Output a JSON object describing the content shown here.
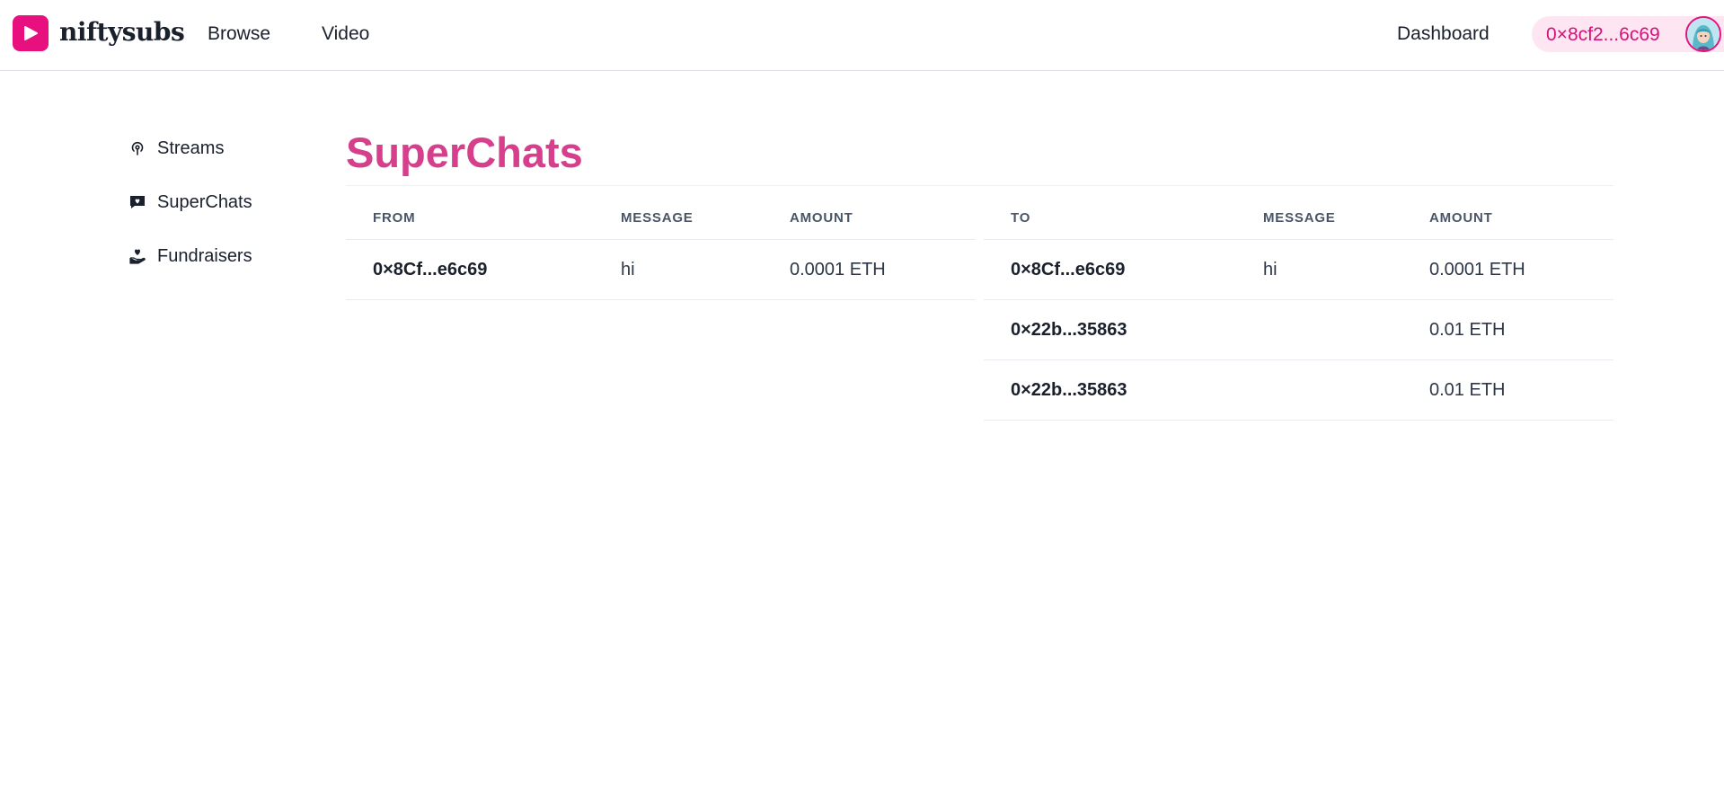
{
  "header": {
    "brand": "niftysubs",
    "nav": [
      "Browse",
      "Video"
    ],
    "dashboard_label": "Dashboard",
    "wallet_address": "0×8cf2...6c69",
    "accent_color": "#e8107e"
  },
  "sidebar": {
    "items": [
      {
        "label": "Streams",
        "icon": "broadcast-icon"
      },
      {
        "label": "SuperChats",
        "icon": "chat-bubble-heart-icon"
      },
      {
        "label": "Fundraisers",
        "icon": "hand-heart-icon"
      }
    ]
  },
  "main": {
    "title": "SuperChats",
    "title_color": "#d53f8c",
    "sent_table": {
      "columns": [
        "FROM",
        "MESSAGE",
        "AMOUNT"
      ],
      "rows": [
        {
          "address": "0×8Cf...e6c69",
          "message": "hi",
          "amount": "0.0001 ETH"
        }
      ]
    },
    "received_table": {
      "columns": [
        "TO",
        "MESSAGE",
        "AMOUNT"
      ],
      "rows": [
        {
          "address": "0×8Cf...e6c69",
          "message": "hi",
          "amount": "0.0001 ETH"
        },
        {
          "address": "0×22b...35863",
          "message": "",
          "amount": "0.01 ETH"
        },
        {
          "address": "0×22b...35863",
          "message": "",
          "amount": "0.01 ETH"
        }
      ]
    }
  }
}
